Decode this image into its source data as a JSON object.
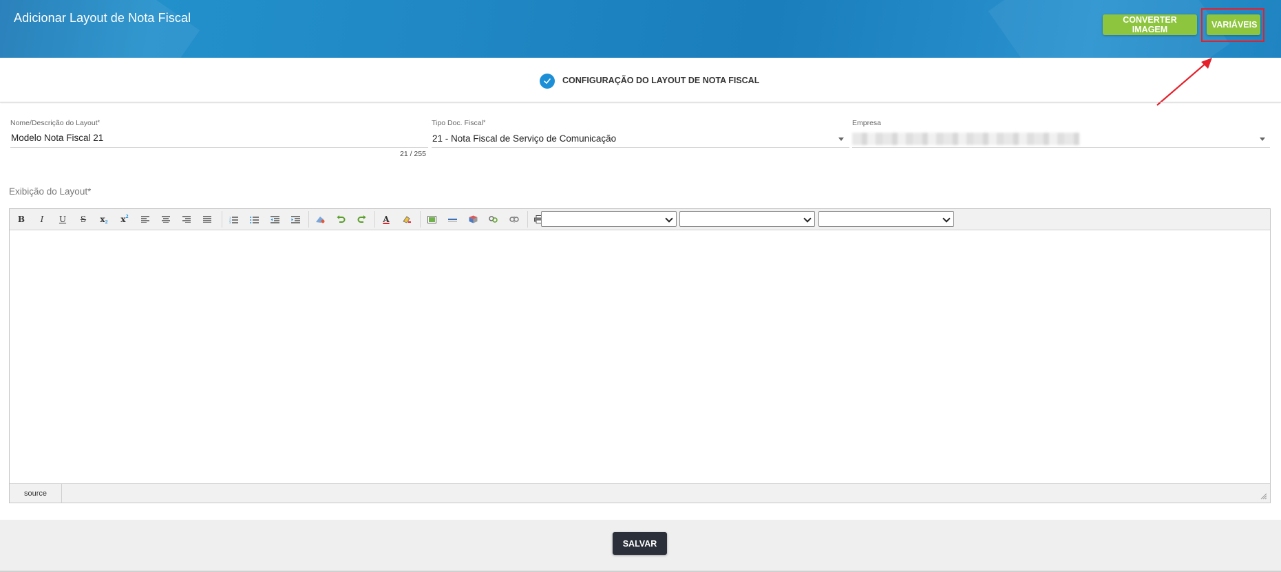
{
  "header": {
    "title": "Adicionar Layout de Nota Fiscal",
    "buttons": {
      "converter_label": "CONVERTER IMAGEM",
      "variaveis_label": "VARIÁVEIS"
    },
    "accent_color": "#8dc53e",
    "annotation_color": "#e5202b"
  },
  "step": {
    "label": "CONFIGURAÇÃO DO LAYOUT DE NOTA FISCAL",
    "status_icon": "check-icon"
  },
  "form": {
    "nome": {
      "label": "Nome/Descrição do Layout",
      "required_mark": "*",
      "value": "Modelo Nota Fiscal 21",
      "counter": "21 / 255"
    },
    "tipo_doc": {
      "label": "Tipo Doc. Fiscal",
      "required_mark": "*",
      "value": "21 - Nota Fiscal de Serviço de Comunicação"
    },
    "empresa": {
      "label": "Empresa",
      "value": ""
    }
  },
  "editor": {
    "section_label": "Exibição do Layout*",
    "toolbar": {
      "bold": "B",
      "italic": "I",
      "underline": "U",
      "strike": "S",
      "subscript": "x",
      "superscript": "x"
    },
    "selects": [
      "",
      "",
      ""
    ],
    "source_label": "source"
  },
  "footer": {
    "save_label": "SALVAR"
  }
}
